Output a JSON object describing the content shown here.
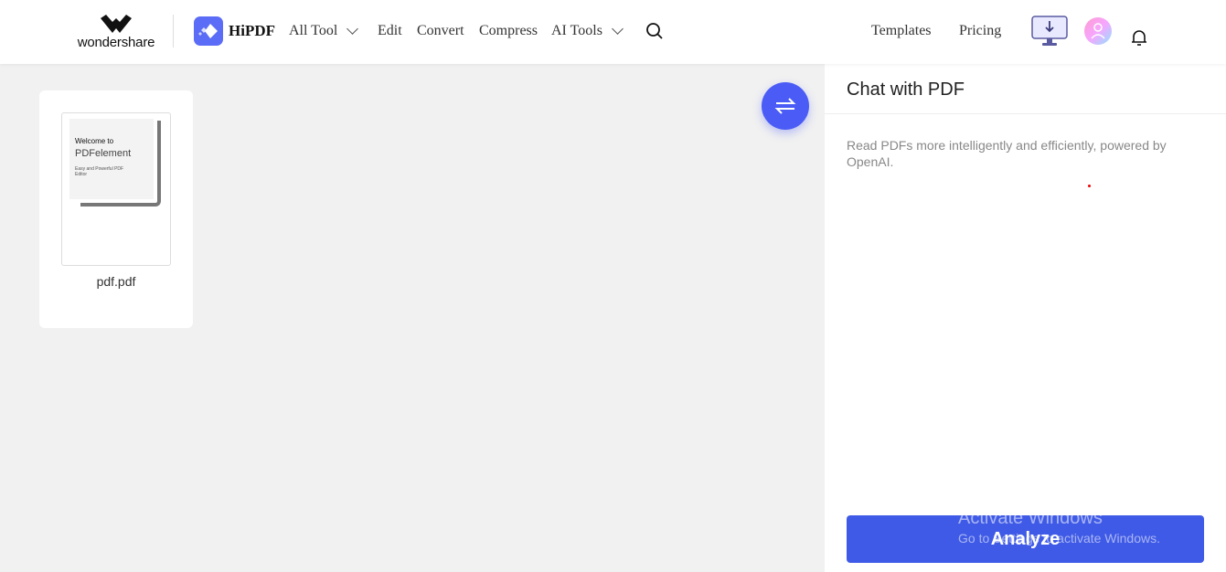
{
  "header": {
    "brand": "wondershare",
    "product": "HiPDF",
    "nav": [
      {
        "label": "All Tool",
        "dropdown": true
      },
      {
        "label": "Edit"
      },
      {
        "label": "Convert"
      },
      {
        "label": "Compress"
      },
      {
        "label": "AI Tools",
        "dropdown": true
      }
    ],
    "right_nav": [
      "Templates",
      "Pricing"
    ],
    "icons": [
      "search-icon",
      "desktop-download-icon",
      "avatar",
      "bell-icon"
    ]
  },
  "file": {
    "name": "pdf.pdf",
    "thumb": {
      "line1": "Welcome to",
      "line2": "PDFelement",
      "line3": "Easy and Powerful PDF Editor"
    }
  },
  "panel": {
    "title": "Chat with PDF",
    "description": "Read PDFs more intelligently and efficiently, powered by OpenAI.",
    "analyze_label": "Analyze"
  },
  "watermark": {
    "line1": "Activate Windows",
    "line2": "Go to Settings to activate Windows."
  },
  "colors": {
    "accent": "#3f5ae6",
    "swap_button": "#4a5cf5",
    "brand_icon": "#5b6cf6"
  }
}
